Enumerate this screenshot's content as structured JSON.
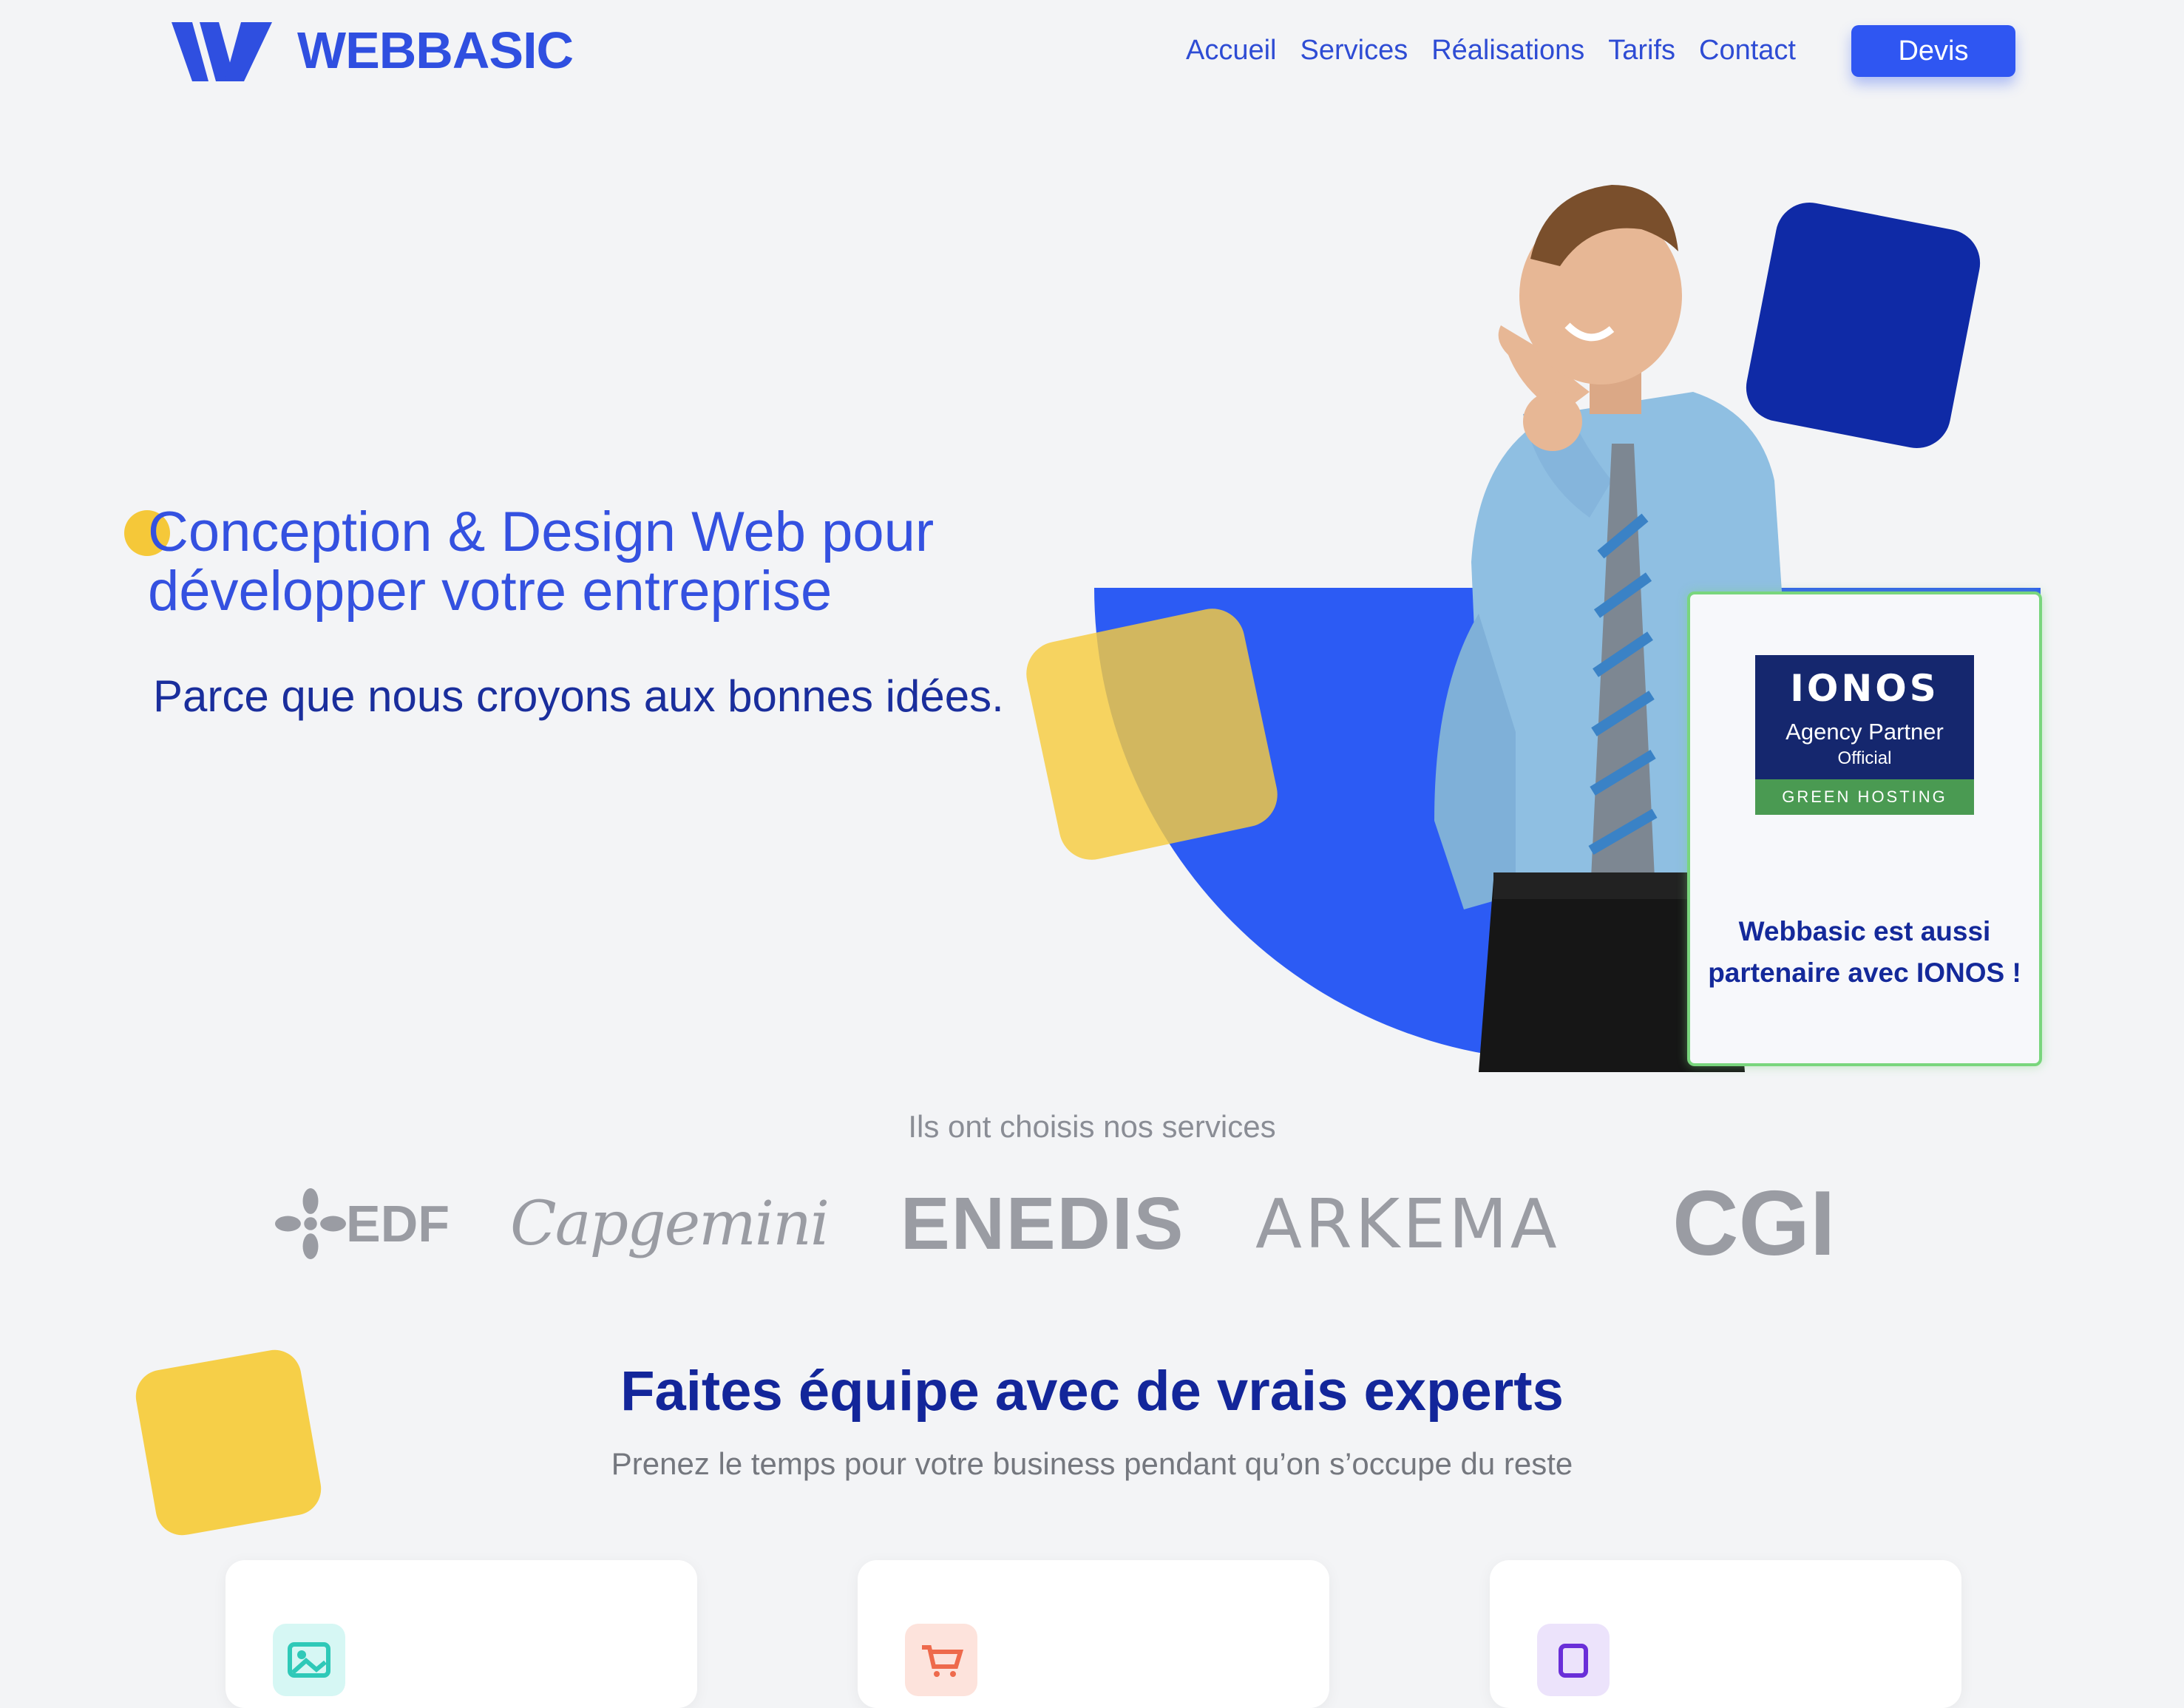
{
  "header": {
    "brand": "WEBBASIC",
    "nav": [
      "Accueil",
      "Services",
      "Réalisations",
      "Tarifs",
      "Contact"
    ],
    "cta_label": "Devis"
  },
  "hero": {
    "title": "Conception & Design Web pour développer votre entreprise",
    "subtitle": "Parce que nous croyons aux bonnes idées."
  },
  "partner": {
    "badge_brand": "IONOS",
    "badge_line2": "Agency Partner",
    "badge_line3": "Official",
    "badge_footer": "GREEN HOSTING",
    "text": "Webbasic est aussi partenaire avec IONOS !"
  },
  "clients": {
    "title": "Ils ont choisis nos services",
    "logos": [
      "EDF",
      "Capgemini",
      "ENEDIS",
      "ARKEMA",
      "CGI"
    ]
  },
  "experts": {
    "title": "Faites équipe avec de vrais experts",
    "subtitle": "Prenez le temps pour votre business pendant qu’on s’occupe du reste"
  },
  "cards": [
    {
      "icon": "image-icon",
      "color": "#d6f7f4"
    },
    {
      "icon": "shopping-cart-icon",
      "color": "#fde3dc"
    },
    {
      "icon": "device-icon",
      "color": "#ece3fb"
    }
  ],
  "colors": {
    "accent": "#2f56f2",
    "navy": "#13269a",
    "yellow": "#f6cf48",
    "background": "#f3f4f6"
  }
}
